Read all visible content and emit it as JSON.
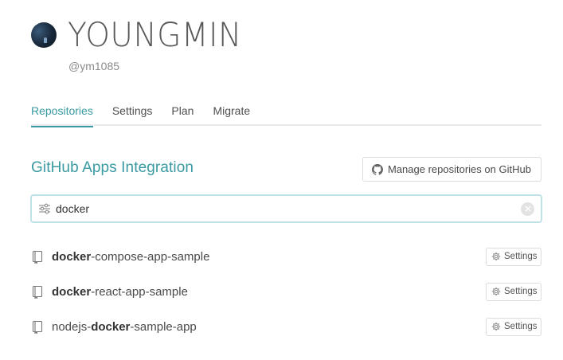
{
  "profile": {
    "display_name": "YOUNGMIN",
    "username": "@ym1085"
  },
  "tabs": [
    {
      "label": "Repositories",
      "active": true
    },
    {
      "label": "Settings",
      "active": false
    },
    {
      "label": "Plan",
      "active": false
    },
    {
      "label": "Migrate",
      "active": false
    }
  ],
  "section": {
    "title": "GitHub Apps Integration",
    "manage_button_label": "Manage repositories on GitHub"
  },
  "search": {
    "value": "docker",
    "placeholder": ""
  },
  "repositories": [
    {
      "parts": [
        {
          "text": "docker",
          "bold": true
        },
        {
          "text": "-compose-app-sample",
          "bold": false
        }
      ],
      "settings_label": "Settings"
    },
    {
      "parts": [
        {
          "text": "docker",
          "bold": true
        },
        {
          "text": "-react-app-sample",
          "bold": false
        }
      ],
      "settings_label": "Settings"
    },
    {
      "parts": [
        {
          "text": "nodejs-",
          "bold": false
        },
        {
          "text": "docker",
          "bold": true
        },
        {
          "text": "-sample-app",
          "bold": false
        }
      ],
      "settings_label": "Settings"
    }
  ],
  "colors": {
    "accent": "#3a9aa2",
    "search_border": "#bfe3e4"
  },
  "icons": {
    "github": "github-icon",
    "filter": "filter-sliders-icon",
    "clear": "clear-circle-icon",
    "repo": "repo-book-icon",
    "gear": "gear-icon"
  }
}
